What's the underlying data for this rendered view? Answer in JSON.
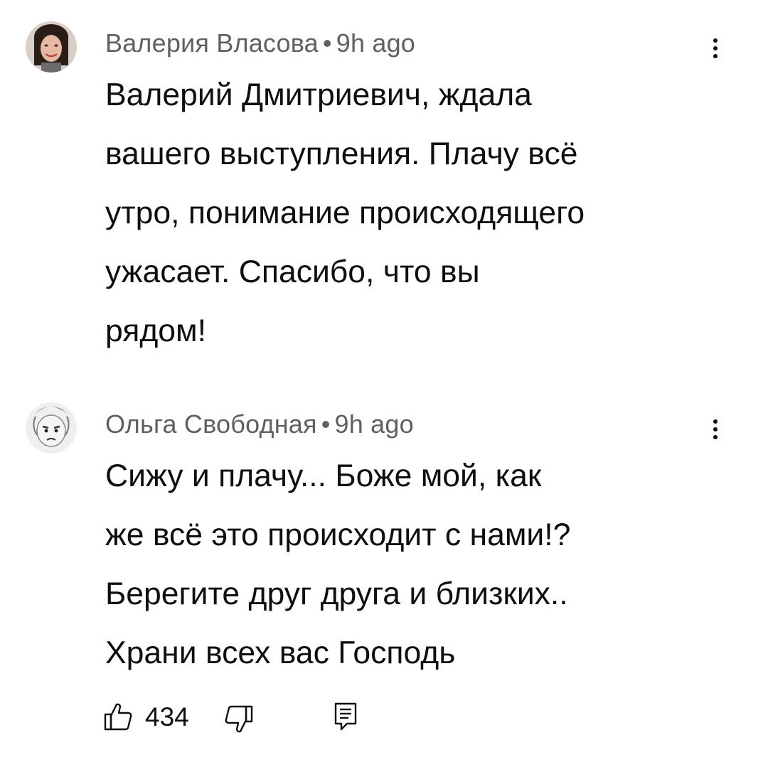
{
  "comments": [
    {
      "author": "Валерия Власова",
      "separator": "•",
      "time": "9h ago",
      "avatar_icon": "avatar-woman-photo",
      "menu_icon": "more-vert-icon",
      "lines": [
        "Валерий Дмитриевич,  ждала",
        "вашего выступления. Плачу всё",
        "утро, понимание происходящего",
        "ужасает. Спасибо, что вы",
        "рядом!"
      ]
    },
    {
      "author": "Ольга Свободная",
      "separator": "•",
      "time": "9h ago",
      "avatar_icon": "avatar-child-sketch",
      "menu_icon": "more-vert-icon",
      "lines": [
        "Сижу и плачу... Боже мой, как",
        "же всё это происходит с нами!?",
        "Берегите друг друга и близких..",
        "Храни всех вас Господь"
      ]
    }
  ],
  "actions": {
    "like_icon": "thumbs-up-icon",
    "like_count": "434",
    "dislike_icon": "thumbs-down-icon",
    "reply_icon": "reply-icon"
  },
  "colors": {
    "text": "#0f0f0f",
    "meta": "#606060",
    "background": "#ffffff"
  }
}
